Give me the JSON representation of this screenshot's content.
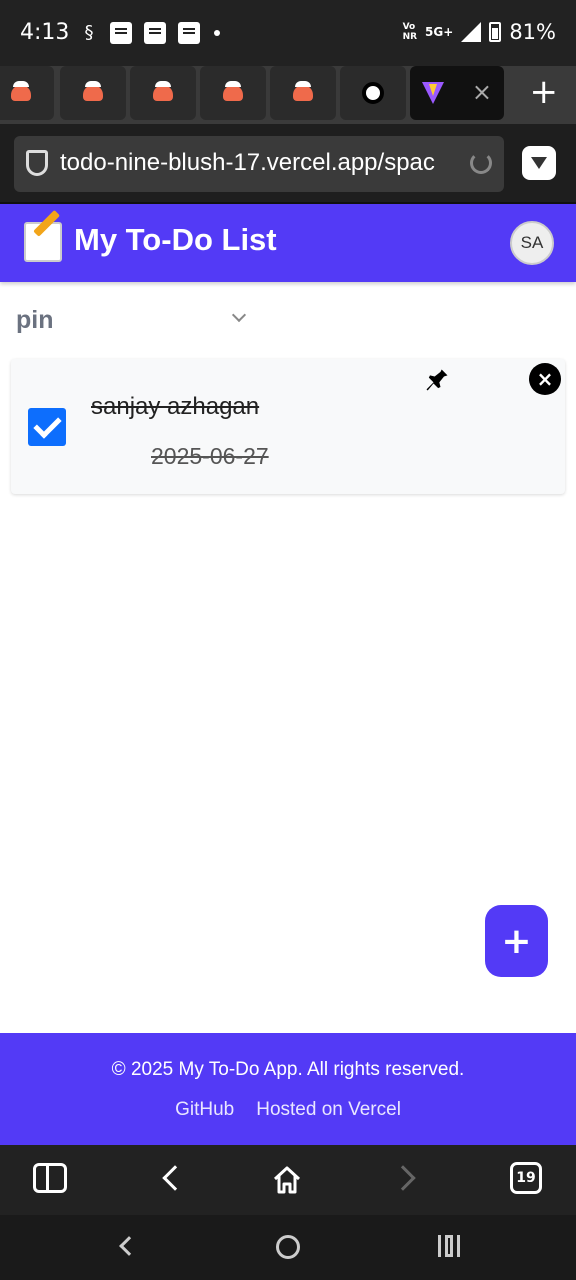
{
  "status_bar": {
    "time": "4:13",
    "network": "5G+",
    "volte": "Vo\nNR",
    "battery": "81%"
  },
  "browser": {
    "url": "todo-nine-blush-17.vercel.app/spac",
    "tab_close": "×",
    "new_tab": "+",
    "tab_count": "19"
  },
  "app": {
    "title": "My To-Do List",
    "avatar_initials": "SA",
    "filter": {
      "selected": "pin"
    },
    "todos": [
      {
        "title": "sanjay azhagan",
        "date": "2025-06-27",
        "completed": true,
        "pinned": true
      }
    ],
    "delete_label": "×",
    "fab_label": "+",
    "footer": {
      "copyright": "© 2025 My To-Do App. All rights reserved.",
      "links": [
        "GitHub",
        "Hosted on Vercel"
      ]
    }
  },
  "colors": {
    "primary": "#533af6",
    "checkbox": "#0d6efd"
  },
  "icons": [
    "shield-icon",
    "reload-icon",
    "pin-icon",
    "close-icon",
    "chevron-down-icon",
    "home-icon"
  ]
}
